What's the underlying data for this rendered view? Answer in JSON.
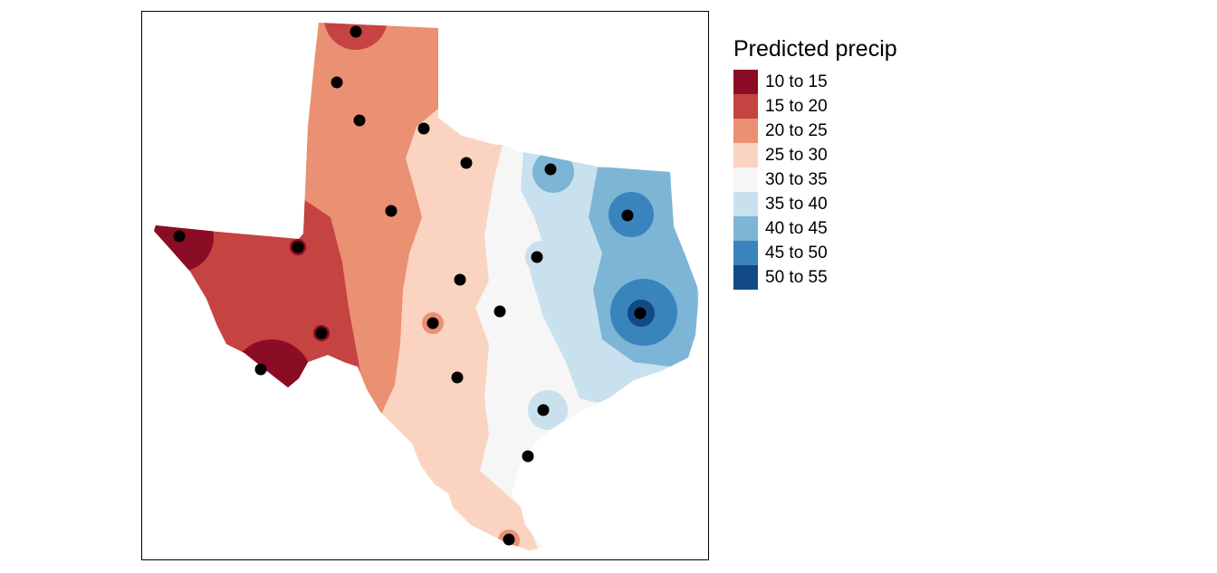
{
  "legend": {
    "title": "Predicted precip",
    "classes": [
      {
        "label": "10 to 15",
        "color": "#8B0C25"
      },
      {
        "label": "15 to 20",
        "color": "#C54340"
      },
      {
        "label": "20 to 25",
        "color": "#EA9073"
      },
      {
        "label": "25 to 30",
        "color": "#FAD4C0"
      },
      {
        "label": "30 to 35",
        "color": "#F6F6F6"
      },
      {
        "label": "35 to 40",
        "color": "#C9E1EE"
      },
      {
        "label": "40 to 45",
        "color": "#7DB5D7"
      },
      {
        "label": "45 to 50",
        "color": "#3A84BD"
      },
      {
        "label": "50 to 55",
        "color": "#124A85"
      }
    ]
  },
  "chart_data": {
    "type": "heatmap",
    "title": "",
    "subject": "Interpolated precipitation surface over Texas with station points",
    "legend_title": "Predicted precip",
    "legend_position": "right",
    "classes": [
      "10 to 15",
      "15 to 20",
      "20 to 25",
      "25 to 30",
      "30 to 35",
      "35 to 40",
      "40 to 45",
      "45 to 50",
      "50 to 55"
    ],
    "station_count": 21,
    "gradient": "precipitation increases from west (10-20) to east (45-55)"
  }
}
